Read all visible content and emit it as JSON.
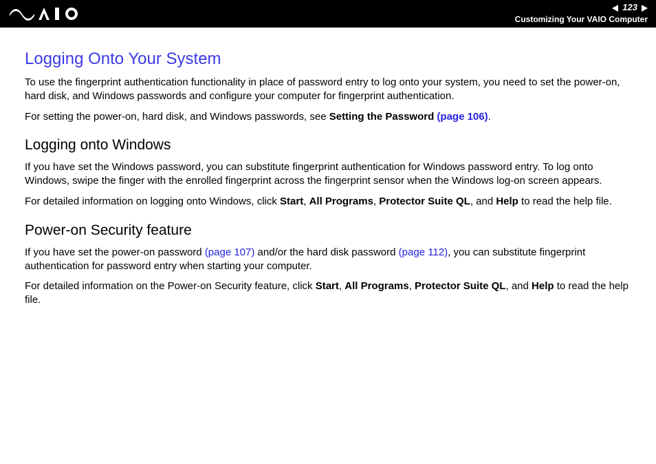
{
  "header": {
    "page_number": "123",
    "section_title": "Customizing Your VAIO Computer"
  },
  "content": {
    "h1": "Logging Onto Your System",
    "p1": "To use the fingerprint authentication functionality in place of password entry to log onto your system, you need to set the power-on, hard disk, and Windows passwords and configure your computer for fingerprint authentication.",
    "p2_pre": "For setting the power-on, hard disk, and Windows passwords, see ",
    "p2_bold": "Setting the Password ",
    "p2_link": "(page 106)",
    "p2_post": ".",
    "h2a": "Logging onto Windows",
    "p3": "If you have set the Windows password, you can substitute fingerprint authentication for Windows password entry. To log onto Windows, swipe the finger with the enrolled fingerprint across the fingerprint sensor when the Windows log-on screen appears.",
    "p4_a": "For detailed information on logging onto Windows, click ",
    "p4_b1": "Start",
    "p4_c1": ", ",
    "p4_b2": "All Programs",
    "p4_c2": ", ",
    "p4_b3": "Protector Suite QL",
    "p4_c3": ", and ",
    "p4_b4": "Help",
    "p4_c4": " to read the help file.",
    "h2b": "Power-on Security feature",
    "p5_a": "If you have set the power-on password ",
    "p5_l1": "(page 107)",
    "p5_b": " and/or the hard disk password ",
    "p5_l2": "(page 112)",
    "p5_c": ", you can substitute fingerprint authentication for password entry when starting your computer.",
    "p6_a": "For detailed information on the Power-on Security feature, click ",
    "p6_b1": "Start",
    "p6_c1": ", ",
    "p6_b2": "All Programs",
    "p6_c2": ", ",
    "p6_b3": "Protector Suite QL",
    "p6_c3": ", and ",
    "p6_b4": "Help",
    "p6_c4": " to read the help file."
  }
}
